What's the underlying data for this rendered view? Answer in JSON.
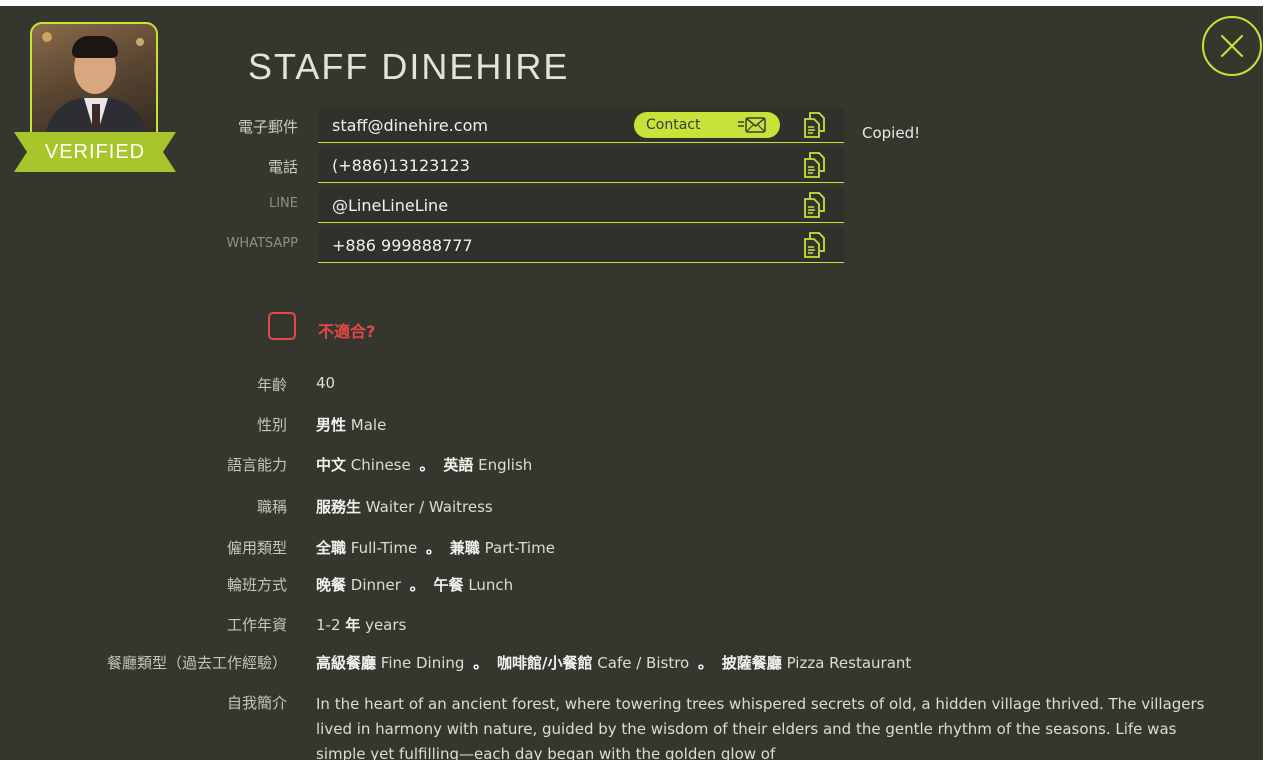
{
  "profile": {
    "name": "STAFF DINEHIRE",
    "verified_label": "VERIFIED"
  },
  "contacts": {
    "email": {
      "label": "電子郵件",
      "value": "staff@dinehire.com",
      "button": "Contact"
    },
    "phone": {
      "label": "電話",
      "value": "(+886)13123123"
    },
    "line": {
      "label": "LINE",
      "value": "@LineLineLine"
    },
    "whatsapp": {
      "label": "WHATSAPP",
      "value": "+886 999888777"
    },
    "copied_notice": "Copied!"
  },
  "unfit": {
    "label": "不適合?"
  },
  "info": {
    "age": {
      "label": "年齡",
      "value": "40"
    },
    "gender": {
      "label": "性別",
      "zh": "男性",
      "en": "Male"
    },
    "languages": {
      "label": "語言能力",
      "items": [
        {
          "zh": "中文",
          "en": "Chinese"
        },
        {
          "zh": "英語",
          "en": "English"
        }
      ]
    },
    "title": {
      "label": "職稱",
      "zh": "服務生",
      "en": "Waiter / Waitress"
    },
    "employment": {
      "label": "僱用類型",
      "items": [
        {
          "zh": "全職",
          "en": "Full-Time"
        },
        {
          "zh": "兼職",
          "en": "Part-Time"
        }
      ]
    },
    "shifts": {
      "label": "輪班方式",
      "items": [
        {
          "zh": "晚餐",
          "en": "Dinner"
        },
        {
          "zh": "午餐",
          "en": "Lunch"
        }
      ]
    },
    "experience": {
      "label": "工作年資",
      "value": "1-2",
      "zh": "年",
      "en": "years"
    },
    "restaurant_types": {
      "label": "餐廳類型（過去工作經驗）",
      "items": [
        {
          "zh": "高級餐廳",
          "en": "Fine Dining"
        },
        {
          "zh": "咖啡館/小餐館",
          "en": "Cafe / Bistro"
        },
        {
          "zh": "披薩餐廳",
          "en": "Pizza Restaurant"
        }
      ]
    },
    "bio": {
      "label": "自我簡介",
      "text": "In the heart of an ancient forest, where towering trees whispered secrets of old, a hidden village thrived. The villagers lived in harmony with nature, guided by the wisdom of their elders and the gentle rhythm of the seasons. Life was simple yet fulfilling—each day began with the golden glow of"
    }
  },
  "separator": "。"
}
